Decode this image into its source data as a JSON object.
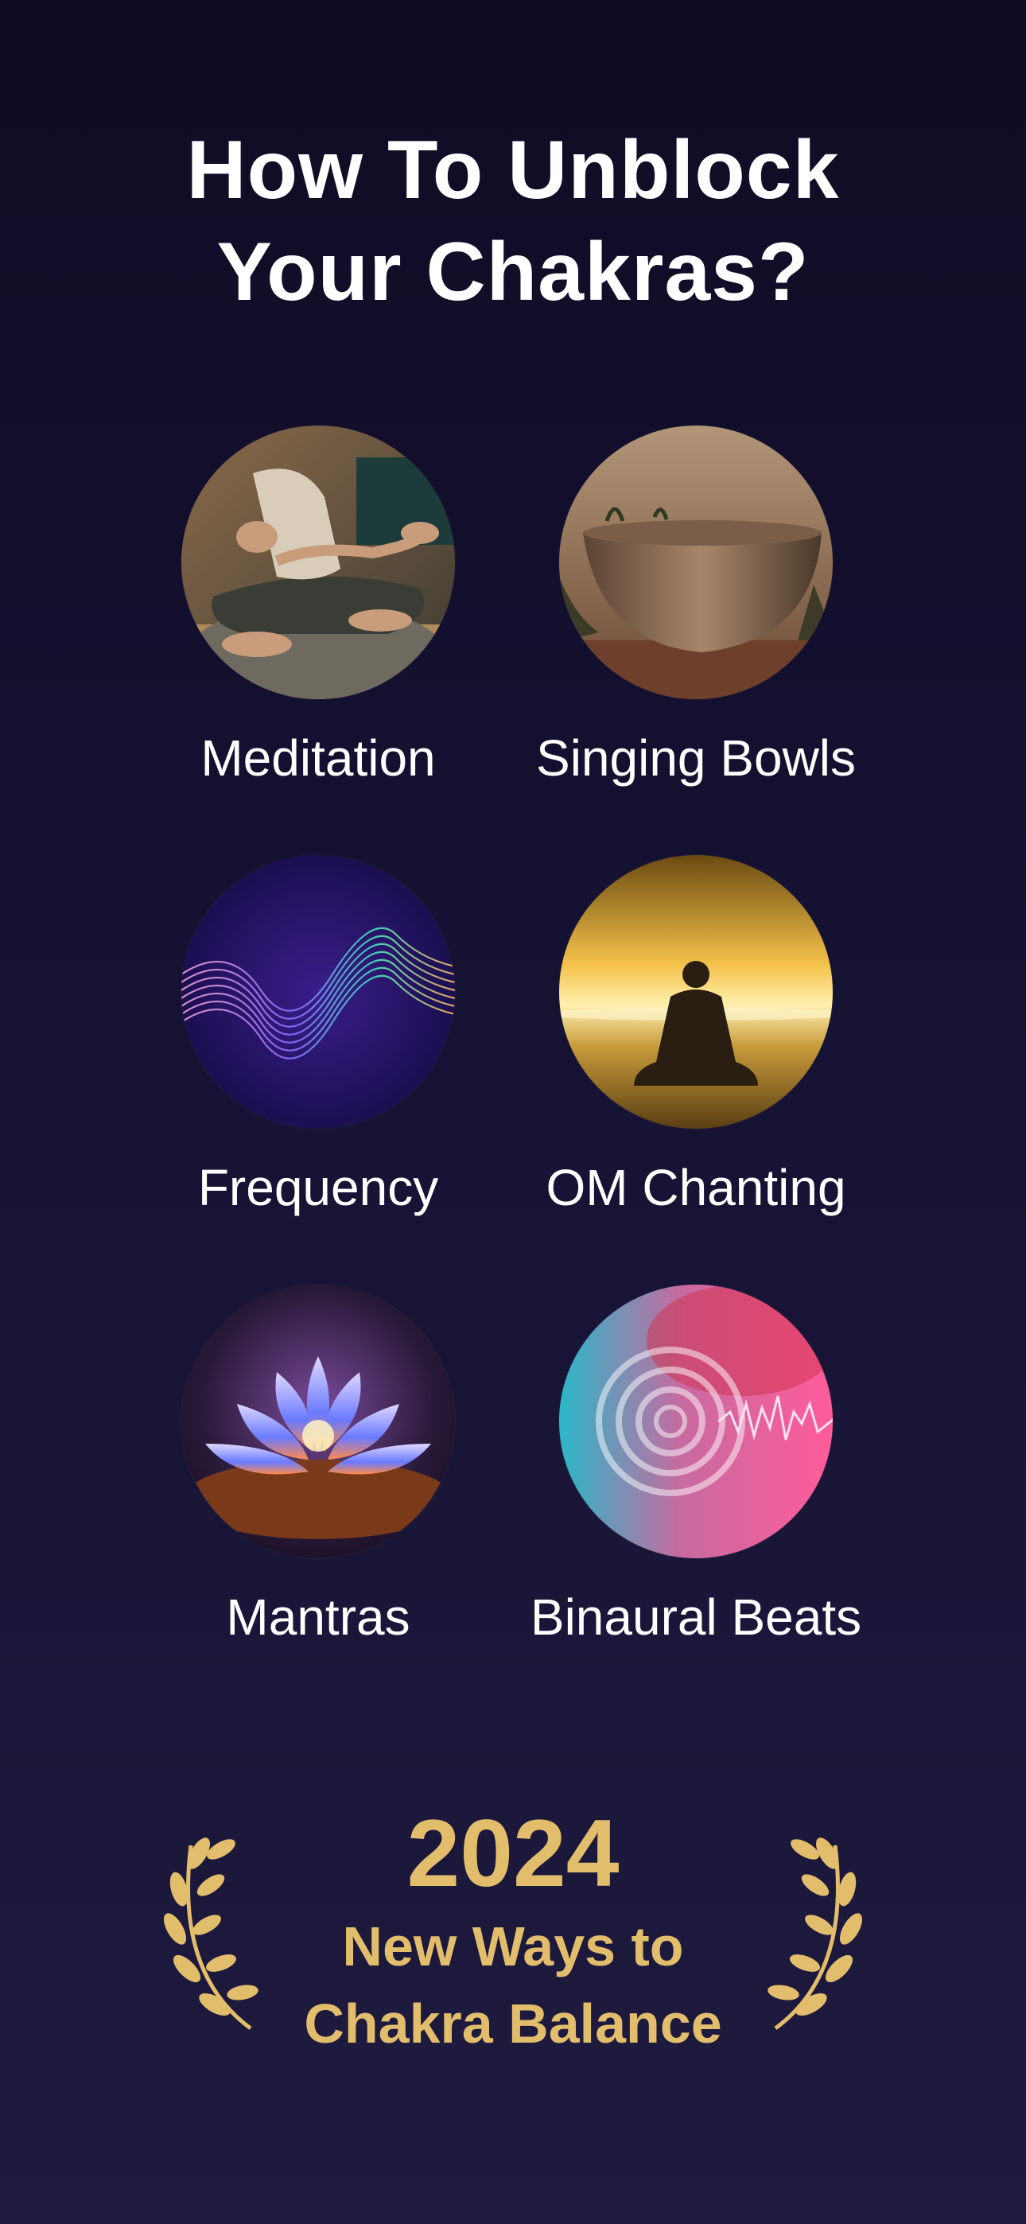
{
  "header": {
    "title_line1": "How To Unblock",
    "title_line2": "Your Chakras?"
  },
  "methods": [
    {
      "label": "Meditation",
      "icon": "meditation-photo"
    },
    {
      "label": "Singing Bowls",
      "icon": "singing-bowl-photo"
    },
    {
      "label": "Frequency",
      "icon": "frequency-waves-art"
    },
    {
      "label": "OM Chanting",
      "icon": "om-chanting-silhouette"
    },
    {
      "label": "Mantras",
      "icon": "lotus-flower-art"
    },
    {
      "label": "Binaural Beats",
      "icon": "binaural-beats-art"
    }
  ],
  "award": {
    "year": "2024",
    "line1": "New Ways to",
    "line2": "Chakra Balance",
    "icon": "laurel-wreath"
  },
  "colors": {
    "background": "#141030",
    "gold": "#e2bd6b",
    "text": "#ffffff"
  }
}
